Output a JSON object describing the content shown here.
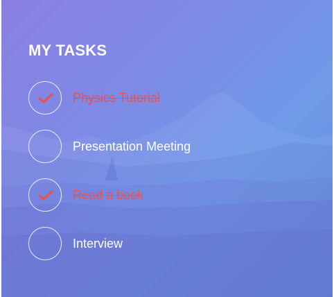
{
  "title": "MY TASKS",
  "tasks": [
    {
      "label": "Physics Tutorial",
      "completed": true
    },
    {
      "label": "Presentation Meeting",
      "completed": false
    },
    {
      "label": "Read a book",
      "completed": true
    },
    {
      "label": "Interview",
      "completed": false
    }
  ],
  "colors": {
    "gradient_start": "#8b7fe0",
    "gradient_end": "#5b8fdc",
    "done_text": "#f0504a",
    "check_mark": "#f0504a",
    "text": "#ffffff"
  }
}
